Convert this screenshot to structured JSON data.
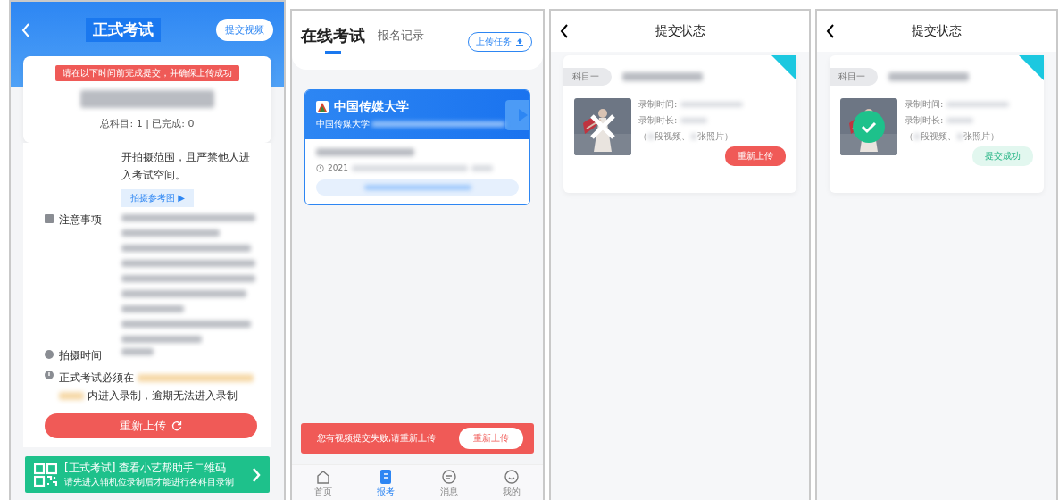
{
  "exam_detail": {
    "title": "正式考试",
    "submit_button": "提交视频",
    "deadline_tip": "请在以下时间前完成提交，并确保上传成功",
    "summary": "总科目: 1 | 已完成: 0",
    "rules_text": "开拍摄范围，且严禁他人进入考试空间。",
    "reference_button": "拍摄参考图 ▶",
    "notes_label": "注意事项",
    "time_label": "拍摄时间",
    "deadline_prefix": "正式考试必须在",
    "deadline_suffix": "内进入录制，逾期无法进入录制",
    "reupload_button": "重新上传",
    "helper": {
      "title": "[正式考试] 查看小艺帮助手二维码",
      "subtitle": "请先进入辅机位录制后才能进行各科目录制"
    }
  },
  "exam_list": {
    "tabs": [
      {
        "label": "在线考试",
        "selected": true
      },
      {
        "label": "报名记录",
        "selected": false
      }
    ],
    "upload_button": "上传任务",
    "card": {
      "school": "中国传媒大学",
      "subtitle": "中国传媒大学",
      "date": "2021"
    },
    "alert": {
      "message": "您有视频提交失败,请重新上传",
      "button": "重新上传"
    },
    "nav": [
      {
        "label": "首页",
        "selected": false
      },
      {
        "label": "报考",
        "selected": true
      },
      {
        "label": "消息",
        "selected": false
      },
      {
        "label": "我的",
        "selected": false
      }
    ]
  },
  "status_pages": [
    {
      "title": "提交状态",
      "subject_tag": "科目一",
      "record_time_label": "录制时间:",
      "duration_label": "录制时长:",
      "counts": [
        "（",
        "段视频、",
        "张照片）"
      ],
      "kind": "failed",
      "action": "重新上传"
    },
    {
      "title": "提交状态",
      "subject_tag": "科目一",
      "record_time_label": "录制时间:",
      "duration_label": "录制时长:",
      "counts": [
        "（",
        "段视频、",
        "张照片）"
      ],
      "kind": "success",
      "action": "提交成功"
    }
  ]
}
